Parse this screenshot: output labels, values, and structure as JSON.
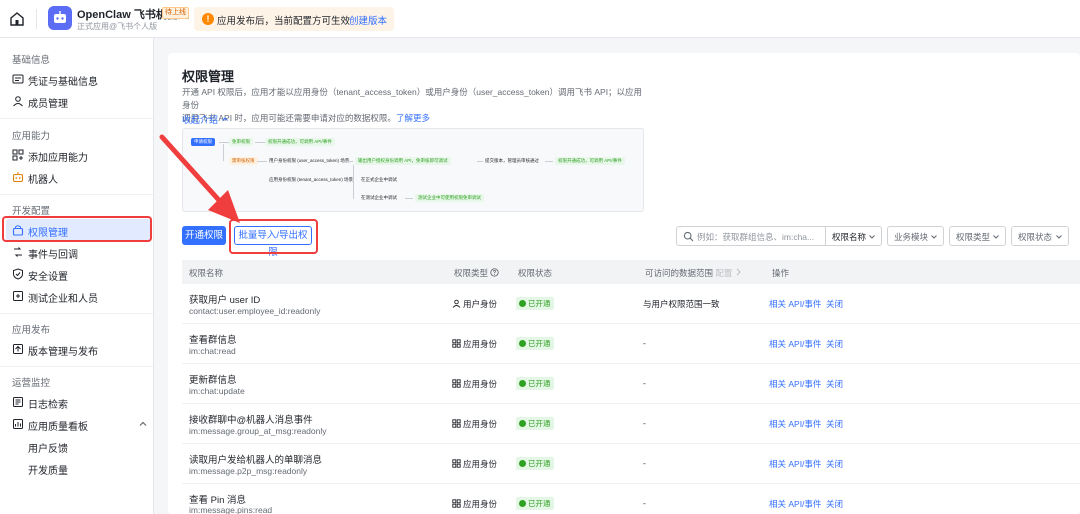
{
  "topbar": {
    "app_name": "OpenClaw 飞书机器人",
    "online_tag": "待上线",
    "app_sub": "正式应用@飞书个人版",
    "notice_text": "应用发布后，当前配置方可生效",
    "notice_link": "创建版本"
  },
  "sidebar": {
    "sections": [
      "基础信息",
      "应用能力",
      "开发配置",
      "应用发布",
      "运营监控"
    ],
    "items": [
      {
        "label": "凭证与基础信息",
        "icon": "credential-icon"
      },
      {
        "label": "成员管理",
        "icon": "member-icon"
      },
      {
        "label": "添加应用能力",
        "icon": "grid-add-icon"
      },
      {
        "label": "机器人",
        "icon": "robot-icon"
      },
      {
        "label": "权限管理",
        "icon": "permission-icon"
      },
      {
        "label": "事件与回调",
        "icon": "event-icon"
      },
      {
        "label": "安全设置",
        "icon": "shield-icon"
      },
      {
        "label": "测试企业和人员",
        "icon": "test-icon"
      },
      {
        "label": "版本管理与发布",
        "icon": "version-icon"
      },
      {
        "label": "日志检索",
        "icon": "log-icon"
      },
      {
        "label": "应用质量看板",
        "icon": "dashboard-icon"
      },
      {
        "label": "用户反馈",
        "icon": ""
      },
      {
        "label": "开发质量",
        "icon": ""
      }
    ]
  },
  "page": {
    "title": "权限管理",
    "desc_line1": "开通 API 权限后，应用才能以应用身份（tenant_access_token）或用户身份（user_access_token）调用飞书 API；以应用身份",
    "desc_line2": "调用飞书 API 时，应用可能还需要申请对应的数据权限。",
    "learn_more": "了解更多",
    "collapse": "收起介绍"
  },
  "flow": {
    "apply": "申请权限",
    "no_review": "免审权限",
    "no_review_result": "权限开通成功，可调用 API/事件",
    "review": "需审核权限",
    "user_token": "用户身份权限 (user_access_token) 场景",
    "tenant_token": "应用身份权限 (tenant_access_token) 场景",
    "user_result": "输出用户授权身份调用 API，免审核即可调试",
    "submit": "提交版本，管理员审核通过",
    "final": "权限开通成功，可调用 API/事件",
    "enterprise_test": "在正式企业中调试",
    "test_enterprise": "在测试企业中调试",
    "test_result": "测试企业中可使用权限免审调试"
  },
  "toolbar": {
    "enable_btn": "开通权限",
    "batch_btn": "批量导入/导出权限",
    "search_placeholder": "例如：获取群组信息、im:cha...",
    "search_scope": "权限名称",
    "filter_module": "业务模块",
    "filter_type": "权限类型",
    "filter_status": "权限状态"
  },
  "table": {
    "headers": {
      "name": "权限名称",
      "type": "权限类型",
      "status": "权限状态",
      "scope": "可访问的数据范围",
      "scope_config": "配置",
      "action": "操作"
    },
    "rows": [
      {
        "name": "获取用户 user ID",
        "code": "contact:user.employee_id:readonly",
        "type": "用户身份",
        "status": "已开通",
        "scope": "与用户权限范围一致",
        "action1": "相关 API/事件",
        "action2": "关闭"
      },
      {
        "name": "查看群信息",
        "code": "im:chat:read",
        "type": "应用身份",
        "status": "已开通",
        "scope": "-",
        "action1": "相关 API/事件",
        "action2": "关闭"
      },
      {
        "name": "更新群信息",
        "code": "im:chat:update",
        "type": "应用身份",
        "status": "已开通",
        "scope": "-",
        "action1": "相关 API/事件",
        "action2": "关闭"
      },
      {
        "name": "接收群聊中@机器人消息事件",
        "code": "im:message.group_at_msg:readonly",
        "type": "应用身份",
        "status": "已开通",
        "scope": "-",
        "action1": "相关 API/事件",
        "action2": "关闭"
      },
      {
        "name": "读取用户发给机器人的单聊消息",
        "code": "im:message.p2p_msg:readonly",
        "type": "应用身份",
        "status": "已开通",
        "scope": "-",
        "action1": "相关 API/事件",
        "action2": "关闭"
      },
      {
        "name": "查看 Pin 消息",
        "code": "im:message.pins:read",
        "type": "应用身份",
        "status": "已开通",
        "scope": "-",
        "action1": "相关 API/事件",
        "action2": "关闭"
      }
    ]
  },
  "colors": {
    "accent": "#3370ff",
    "highlight": "#f03d3d",
    "success": "#2ea121",
    "warning": "#ff8800"
  }
}
